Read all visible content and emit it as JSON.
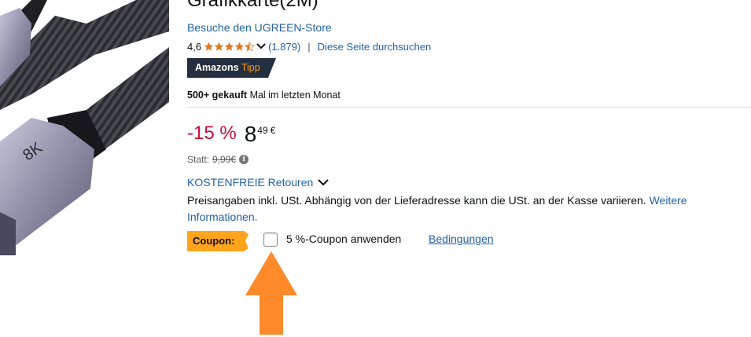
{
  "product": {
    "title": "Grafikkarte(2M)",
    "store_link": "Besuche den UGREEN-Store",
    "rating_value": "4,6",
    "rating_count": "(1.879)",
    "rating_separator": "|",
    "search_link": "Diese Seite durchsuchen",
    "stars": 4.5,
    "image_label": "8K"
  },
  "badge": {
    "amazons": "Amazons",
    "tipp": "Tipp"
  },
  "bought": {
    "count": "500+ gekauft",
    "period": " Mal im letzten Monat"
  },
  "price": {
    "discount": "-15 %",
    "whole": "8",
    "fraction": "49",
    "symbol": "€",
    "statt_label": "Statt:",
    "old_price": "9,99€"
  },
  "returns": {
    "label": "KOSTENFREIE Retouren"
  },
  "vat": {
    "text": "Preisangaben inkl. USt. Abhängig von der Lieferadresse kann die USt. an der Kasse variieren. ",
    "link": "Weitere Informationen."
  },
  "coupon": {
    "badge": "Coupon:",
    "text": "5 %-Coupon anwenden",
    "terms": "Bedingungen",
    "checked": false
  },
  "colors": {
    "link": "#2162a1",
    "discount": "#cc0c39",
    "badge_dark": "#232f3e",
    "badge_orange": "#ff9900",
    "coupon_orange": "#ffa41c",
    "arrow": "#ff8a2a"
  },
  "icons": {
    "star": "star-icon",
    "chevron": "chevron-down-icon",
    "info": "info-icon",
    "arrow": "arrow-up-icon"
  }
}
